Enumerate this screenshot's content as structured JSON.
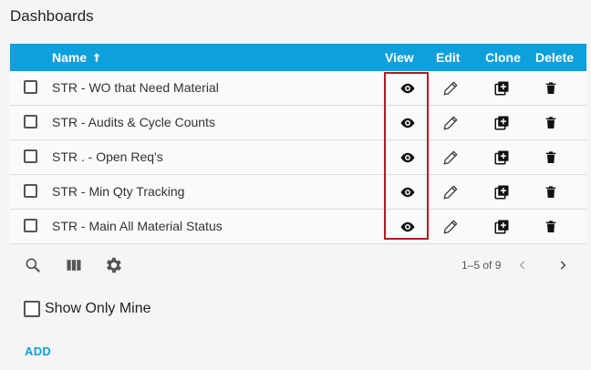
{
  "page": {
    "title": "Dashboards"
  },
  "table": {
    "columns": {
      "name": "Name",
      "view": "View",
      "edit": "Edit",
      "clone": "Clone",
      "delete": "Delete"
    },
    "sort": {
      "column": "Name",
      "direction": "ascending",
      "icon": "arrow-up-icon"
    },
    "rows": [
      {
        "name": "STR - WO that Need Material"
      },
      {
        "name": "STR - Audits & Cycle Counts"
      },
      {
        "name": "STR . - Open Req's"
      },
      {
        "name": "STR - Min Qty Tracking"
      },
      {
        "name": "STR - Main All Material Status"
      }
    ],
    "highlight_color": "#b01c24",
    "header_color": "#0da0dc"
  },
  "toolbar": {
    "icons": [
      "search-icon",
      "columns-icon",
      "gear-icon"
    ],
    "pagination": "1–5 of 9"
  },
  "filters": {
    "show_only_mine_label": "Show Only Mine"
  },
  "actions": {
    "add_label": "ADD",
    "accent": "#0e9fdb"
  }
}
